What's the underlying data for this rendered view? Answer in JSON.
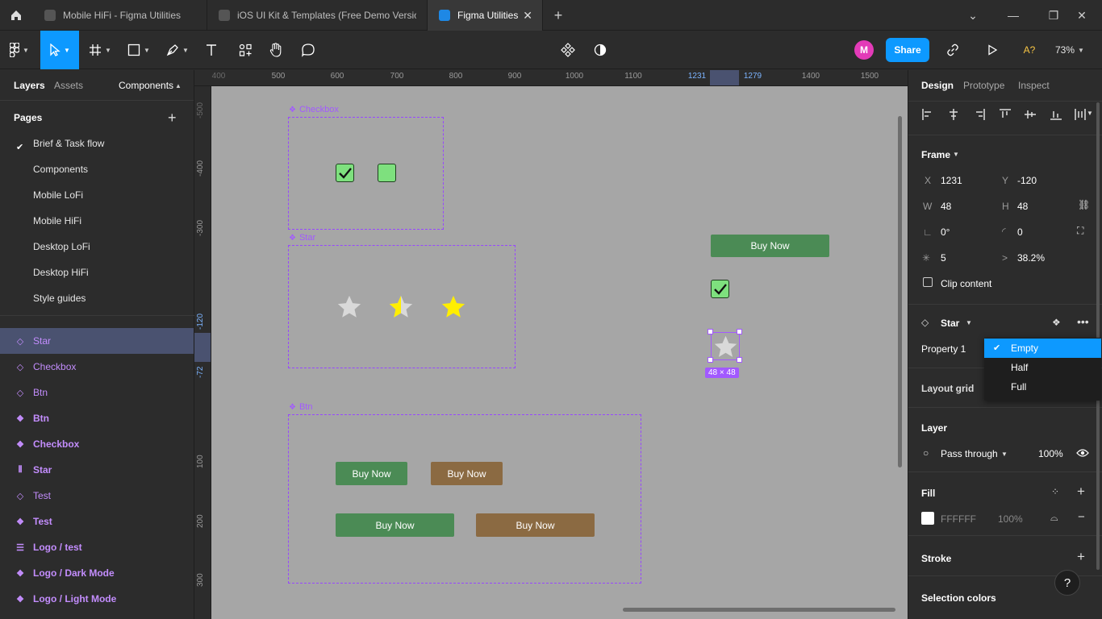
{
  "tabs": [
    {
      "label": "Mobile HiFi - Figma Utilities"
    },
    {
      "label": "iOS UI Kit & Templates (Free Demo Version"
    },
    {
      "label": "Figma Utilities"
    }
  ],
  "toolbar": {
    "avatar_initial": "M",
    "share_label": "Share",
    "fonts_label": "A?",
    "zoom": "73%"
  },
  "left": {
    "tabs": {
      "layers": "Layers",
      "assets": "Assets",
      "components": "Components"
    },
    "pages_title": "Pages",
    "pages": [
      {
        "label": "Brief & Task flow",
        "current": false
      },
      {
        "label": "Components",
        "current": true
      },
      {
        "label": "Mobile LoFi",
        "current": false
      },
      {
        "label": "Mobile HiFi",
        "current": false
      },
      {
        "label": "Desktop LoFi",
        "current": false
      },
      {
        "label": "Desktop HiFi",
        "current": false
      },
      {
        "label": "Style guides",
        "current": false
      }
    ],
    "layers": [
      {
        "label": "Star",
        "icon": "component-set-icon",
        "selected": true
      },
      {
        "label": "Checkbox",
        "icon": "component-set-icon"
      },
      {
        "label": "Btn",
        "icon": "component-set-icon"
      },
      {
        "label": "Btn",
        "icon": "component-icon"
      },
      {
        "label": "Checkbox",
        "icon": "component-icon"
      },
      {
        "label": "Star",
        "icon": "auto-layout-icon"
      },
      {
        "label": "Test",
        "icon": "component-set-icon"
      },
      {
        "label": "Test",
        "icon": "component-icon"
      },
      {
        "label": "Logo / test",
        "icon": "list-icon"
      },
      {
        "label": "Logo / Dark Mode",
        "icon": "component-icon"
      },
      {
        "label": "Logo / Light Mode",
        "icon": "component-icon"
      }
    ]
  },
  "ruler": {
    "top": [
      "400",
      "500",
      "600",
      "700",
      "800",
      "900",
      "1000",
      "1100",
      "1231",
      "1279",
      "1400",
      "1500"
    ],
    "left": [
      "-500",
      "-400",
      "-300",
      "-120",
      "-72",
      "100",
      "200",
      "300"
    ]
  },
  "canvas": {
    "frames": {
      "checkbox": "Checkbox",
      "star": "Star",
      "btn": "Btn"
    },
    "buttons": [
      "Buy Now",
      "Buy Now",
      "Buy Now",
      "Buy Now",
      "Buy Now"
    ],
    "size_badge": "48 × 48"
  },
  "right": {
    "tabs": {
      "design": "Design",
      "prototype": "Prototype",
      "inspect": "Inspect"
    },
    "frame_title": "Frame",
    "x_label": "X",
    "x": "1231",
    "y_label": "Y",
    "y": "-120",
    "w_label": "W",
    "w": "48",
    "h_label": "H",
    "h": "48",
    "rotation": "0°",
    "radius": "0",
    "points": "5",
    "ratio": "38.2%",
    "clip_content": "Clip content",
    "component_name": "Star",
    "property_label": "Property 1",
    "layout_grid": "Layout grid",
    "layer_title": "Layer",
    "blend": "Pass through",
    "opacity": "100%",
    "fill_title": "Fill",
    "fill_hex": "FFFFFF",
    "fill_opacity": "100%",
    "stroke_title": "Stroke",
    "selection_colors": "Selection colors",
    "help": "?"
  },
  "dropdown": {
    "options": [
      {
        "label": "Empty",
        "selected": true
      },
      {
        "label": "Half",
        "selected": false
      },
      {
        "label": "Full",
        "selected": false
      }
    ]
  },
  "colors": {
    "accent": "#0d99ff",
    "component": "#a259ff",
    "star_yellow": "#ffee00",
    "button_green": "#4b8b55",
    "button_brown": "#8b6a42",
    "checkbox_green": "#7ee07e"
  }
}
